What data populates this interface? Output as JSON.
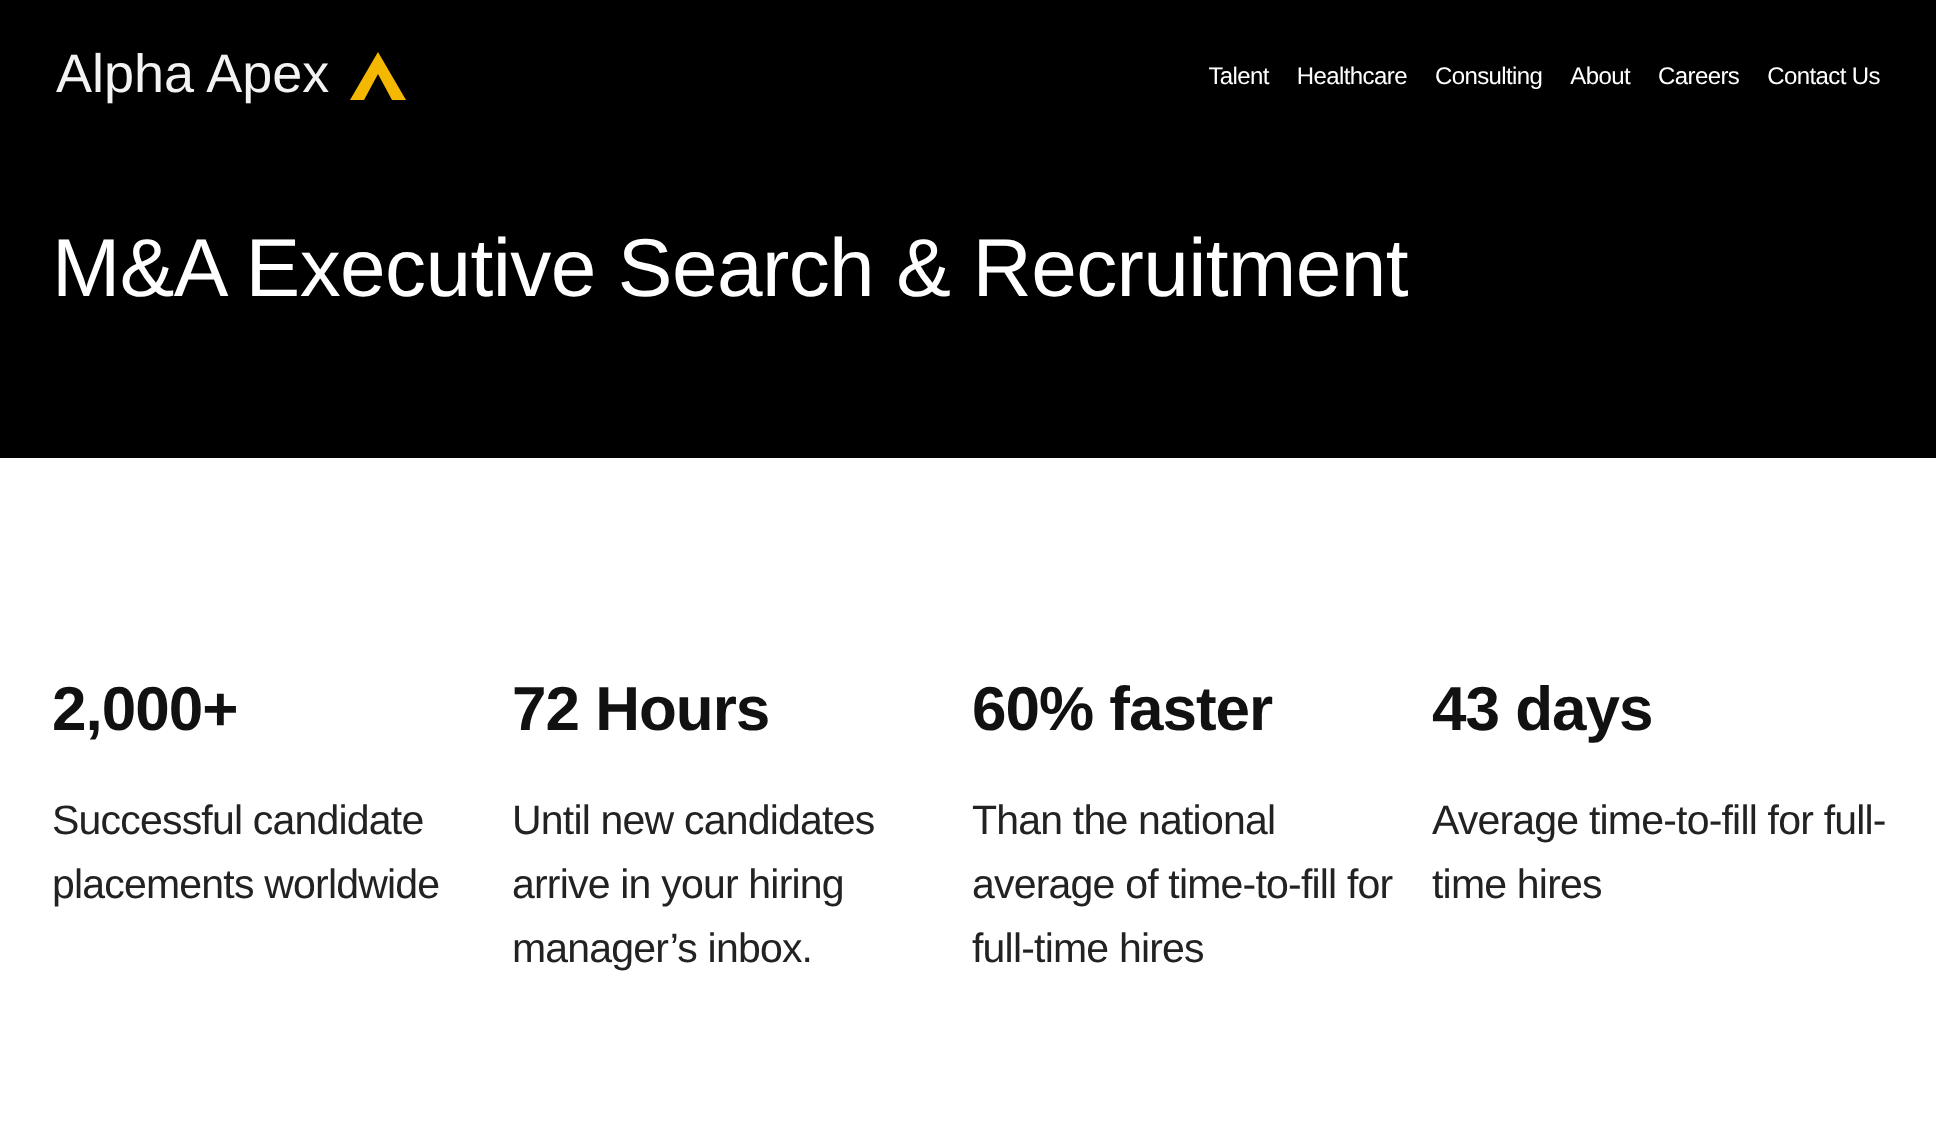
{
  "header": {
    "logo": "Alpha Apex",
    "nav": [
      {
        "label": "Talent"
      },
      {
        "label": "Healthcare"
      },
      {
        "label": "Consulting"
      },
      {
        "label": "About"
      },
      {
        "label": "Careers"
      },
      {
        "label": "Contact Us"
      }
    ],
    "title": "M&A Executive Search & Recruitment"
  },
  "stats": [
    {
      "value": "2,000+",
      "description": "Successful candidate placements worldwide"
    },
    {
      "value": "72 Hours",
      "description": "Until new candidates arrive in your hiring manager’s inbox."
    },
    {
      "value": "60% faster",
      "description": "Than the national average of time-to-fill for full-time hires"
    },
    {
      "value": "43 days",
      "description": "Average time-to-fill for full-time hires"
    }
  ]
}
